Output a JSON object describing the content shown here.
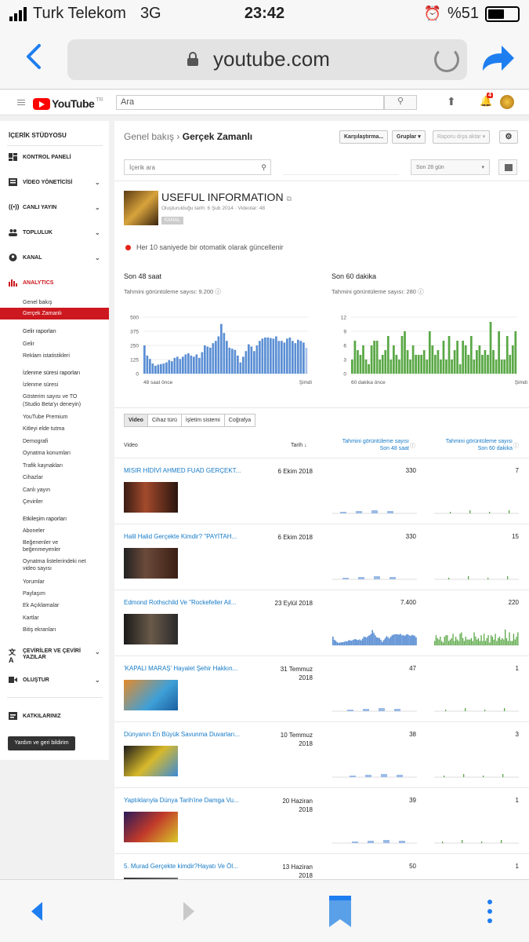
{
  "status": {
    "carrier": "Turk Telekom",
    "network": "3G",
    "time": "23:42",
    "battery": "%51"
  },
  "browser": {
    "url": "youtube.com"
  },
  "yt": {
    "logo_text": "YouTube",
    "region": "TR",
    "search_placeholder": "Ara",
    "notif_count": "4"
  },
  "sidebar": {
    "title": "İÇERİK STÜDYOSU",
    "items": [
      {
        "label": "KONTROL PANELİ"
      },
      {
        "label": "VİDEO YÖNETİCİSİ"
      },
      {
        "label": "CANLI YAYIN"
      },
      {
        "label": "TOPLULUK"
      },
      {
        "label": "KANAL"
      },
      {
        "label": "ANALYTICS"
      }
    ],
    "analytics_sub": [
      "Genel bakış",
      "Gerçek Zamanlı"
    ],
    "revenue_head": "Gelir raporları",
    "revenue": [
      "Gelir",
      "Reklam istatistikleri"
    ],
    "watch_head": "İzlenme süresi raporları",
    "watch": [
      "İzlenme süresi",
      "Gösterim sayısı ve TO",
      "(Studio Beta'yı deneyin)",
      "YouTube Premium",
      "Kitleyi elde tutma",
      "Demografi",
      "Oynatma konumları",
      "Trafik kaynakları",
      "Cihazlar",
      "Canlı yayın",
      "Çeviriler"
    ],
    "engage_head": "Etkileşim raporları",
    "engage": [
      "Aboneler",
      "Beğenenler ve",
      "beğenmeyenler",
      "Oynatma listelerindeki net",
      "video sayısı",
      "Yorumlar",
      "Paylaşım",
      "Ek Açıklamalar",
      "Kartlar",
      "Bitiş ekranları"
    ],
    "translations_1": "ÇEVİRİLER VE ÇEVİRİ",
    "translations_2": "YAZILAR",
    "create": "OLUŞTUR",
    "contrib": "KATKILARINIZ",
    "help": "Yardım ve geri bildirim"
  },
  "main": {
    "breadcrumb_root": "Genel bakış",
    "breadcrumb_sep": "›",
    "breadcrumb_current": "Gerçek Zamanlı",
    "compare_btn": "Karşılaştırma...",
    "groups_btn": "Gruplar ▾",
    "export_btn": "Raporu dışa aktar ▾",
    "search_placeholder": "İçerik ara",
    "date_range": "Son 28 gün",
    "channel": {
      "title": "USEFUL INFORMATION",
      "meta": "Oluşturulduğu tarih: 6 Şub 2014 · Videolar: 48",
      "tag": "KANAL"
    },
    "live_note": "Her 10 saniyede bir otomatik olarak güncellenir",
    "panel48": {
      "title": "Son 48 saat",
      "sub": "Tahmini görüntüleme sayısı: 9.200",
      "left": "48 saat önce",
      "right": "Şimdi"
    },
    "panel60": {
      "title": "Son 60 dakika",
      "sub": "Tahmini görüntüleme sayısı: 280",
      "left": "60 dakika önce",
      "right": "Şimdi"
    },
    "tabs": [
      "Video",
      "Cihaz türü",
      "İşletim sistemi",
      "Coğrafya"
    ],
    "table": {
      "col_video": "Video",
      "col_date": "Tarih",
      "col_48_a": "Tahmini görüntüleme sayısı",
      "col_48_b": "Son 48 saat",
      "col_60_a": "Tahmini görüntüleme sayısı",
      "col_60_b": "Son 60 dakika",
      "rows": [
        {
          "title": "MISIR HİDİVİ AHMED FUAD GERÇEKT...",
          "date": "6 Ekim 2018",
          "v48": "330",
          "v60": "7"
        },
        {
          "title": "Halil Halid Gerçekte Kimdir? \"PAYİTAH...",
          "date": "6 Ekim 2018",
          "v48": "330",
          "v60": "15"
        },
        {
          "title": "Edmond Rothschild Ve \"Rockefeller Ail...",
          "date": "23 Eylül 2018",
          "v48": "7.400",
          "v60": "220"
        },
        {
          "title": "'KAPALI MARAŞ' Hayalet Şehir Hakkın...",
          "date": "31 Temmuz 2018",
          "v48": "47",
          "v60": "1"
        },
        {
          "title": "Dünyanın En Büyük Savunma Duvarları...",
          "date": "10 Temmuz 2018",
          "v48": "38",
          "v60": "3"
        },
        {
          "title": "Yaptıklarıyla Dünya Tarih'ine Damga Vu...",
          "date": "20 Haziran 2018",
          "v48": "39",
          "v60": "1"
        },
        {
          "title": "5. Murad Gerçekte kimdir?Hayatı Ve Öl...",
          "date": "13 Haziran 2018",
          "v48": "50",
          "v60": "1"
        }
      ]
    }
  },
  "chart_data": [
    {
      "type": "bar",
      "title": "Son 48 saat",
      "xlabel": "",
      "ylabel": "",
      "ylim": [
        0,
        500
      ],
      "yticks": [
        0,
        125,
        250,
        375,
        500
      ],
      "x_start_label": "48 saat önce",
      "x_end_label": "Şimdi",
      "color": "#5b8fd4",
      "values": [
        250,
        160,
        130,
        90,
        70,
        80,
        85,
        90,
        100,
        120,
        110,
        140,
        150,
        130,
        150,
        170,
        180,
        160,
        150,
        170,
        140,
        190,
        250,
        240,
        230,
        270,
        290,
        330,
        440,
        360,
        290,
        230,
        220,
        210,
        160,
        100,
        150,
        200,
        260,
        240,
        200,
        250,
        290,
        310,
        320,
        320,
        315,
        310,
        330,
        290,
        290,
        275,
        310,
        320,
        290,
        270,
        300,
        290,
        275,
        230
      ]
    },
    {
      "type": "bar",
      "title": "Son 60 dakika",
      "xlabel": "",
      "ylabel": "",
      "ylim": [
        0,
        12
      ],
      "yticks": [
        0,
        3,
        6,
        9,
        12
      ],
      "x_start_label": "60 dakika önce",
      "x_end_label": "Şimdi",
      "color": "#5aa846",
      "values": [
        3,
        7,
        5,
        4,
        6,
        3,
        2,
        6,
        7,
        7,
        3,
        4,
        5,
        8,
        3,
        6,
        4,
        3,
        8,
        9,
        5,
        3,
        6,
        4,
        4,
        4,
        5,
        3,
        9,
        6,
        4,
        5,
        3,
        7,
        3,
        8,
        3,
        5,
        7,
        2,
        7,
        6,
        4,
        8,
        3,
        5,
        6,
        4,
        5,
        4,
        11,
        5,
        3,
        9,
        3,
        3,
        8,
        4,
        6,
        9
      ]
    }
  ]
}
